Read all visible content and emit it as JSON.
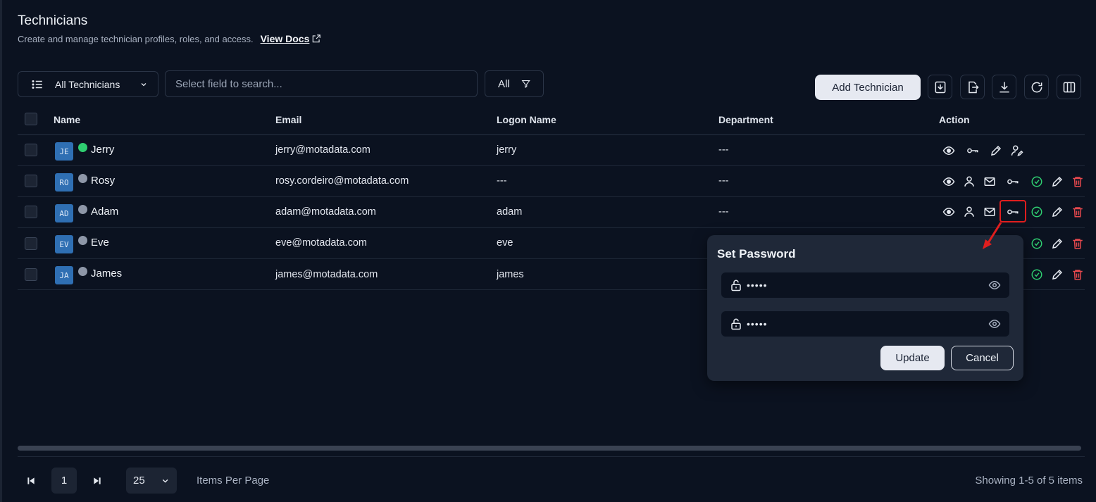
{
  "header": {
    "title": "Technicians",
    "subtitle": "Create and manage technician profiles, roles, and access.",
    "docs_link": "View Docs"
  },
  "toolbar": {
    "view_label": "All Technicians",
    "search_placeholder": "Select field to search...",
    "filter_label": "All",
    "add_button": "Add Technician",
    "tool_icons": [
      "import-icon",
      "export-icon",
      "download-icon",
      "refresh-icon",
      "columns-icon"
    ]
  },
  "table": {
    "columns": [
      "Name",
      "Email",
      "Logon Name",
      "Department",
      "Action"
    ],
    "rows": [
      {
        "initials": "JE",
        "name": "Jerry",
        "status": "online",
        "email": "jerry@motadata.com",
        "logon": "jerry",
        "department": "---"
      },
      {
        "initials": "RO",
        "name": "Rosy",
        "status": "offline",
        "email": "rosy.cordeiro@motadata.com",
        "logon": "---",
        "department": "---"
      },
      {
        "initials": "AD",
        "name": "Adam",
        "status": "offline",
        "email": "adam@motadata.com",
        "logon": "adam",
        "department": "---"
      },
      {
        "initials": "EV",
        "name": "Eve",
        "status": "offline",
        "email": "eve@motadata.com",
        "logon": "eve",
        "department": ""
      },
      {
        "initials": "JA",
        "name": "James",
        "status": "offline",
        "email": "james@motadata.com",
        "logon": "james",
        "department": ""
      }
    ]
  },
  "popover": {
    "title": "Set Password",
    "password_mask": "•••••",
    "confirm_mask": "•••••",
    "update_label": "Update",
    "cancel_label": "Cancel"
  },
  "pagination": {
    "current_page": "1",
    "per_page": "25",
    "per_page_label": "Items Per Page",
    "showing": "Showing 1-5 of 5 items"
  },
  "colors": {
    "background": "#0b1220",
    "online": "#2fce71",
    "danger": "#e5484d",
    "success": "#2fce71",
    "highlight": "#e01e1e"
  }
}
